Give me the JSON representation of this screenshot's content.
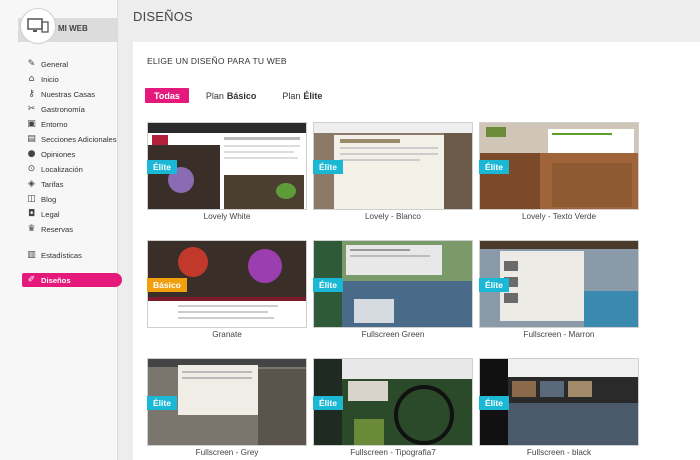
{
  "sidebar": {
    "brand_label": "MI WEB",
    "items": [
      {
        "label": "General",
        "icon": "wrench-icon"
      },
      {
        "label": "Inicio",
        "icon": "house-icon"
      },
      {
        "label": "Nuestras Casas",
        "icon": "key-icon"
      },
      {
        "label": "Gastronomía",
        "icon": "fork-knife-icon"
      },
      {
        "label": "Entorno",
        "icon": "picture-icon"
      },
      {
        "label": "Secciones Adicionales",
        "icon": "document-icon"
      },
      {
        "label": "Opiniones",
        "icon": "speech-bubble-icon"
      },
      {
        "label": "Localización",
        "icon": "map-pin-icon"
      },
      {
        "label": "Tarifas",
        "icon": "price-tag-icon"
      },
      {
        "label": "Blog",
        "icon": "rss-icon"
      },
      {
        "label": "Legal",
        "icon": "lock-icon"
      },
      {
        "label": "Reservas",
        "icon": "trophy-icon"
      },
      {
        "label": "Estadísticas",
        "icon": "bar-chart-icon"
      },
      {
        "label": "Diseños",
        "icon": "brush-icon",
        "active": true
      }
    ]
  },
  "header": {
    "title": "DISEÑOS"
  },
  "main": {
    "heading": "ELIGE UN DISEÑO PARA TU WEB",
    "filters": {
      "all": "Todas",
      "basic_prefix": "Plan",
      "basic_strong": "Básico",
      "elite_prefix": "Plan",
      "elite_strong": "Élite"
    },
    "designs": [
      {
        "name": "Lovely White",
        "badge": "Élite"
      },
      {
        "name": "Lovely - Blanco",
        "badge": "Élite"
      },
      {
        "name": "Lovely - Texto Verde",
        "badge": "Élite"
      },
      {
        "name": "Granate",
        "badge": "Básico"
      },
      {
        "name": "Fullscreen Green",
        "badge": "Élite"
      },
      {
        "name": "Fullscreen - Marron",
        "badge": "Élite"
      },
      {
        "name": "Fullscreen - Grey",
        "badge": "Élite"
      },
      {
        "name": "Fullscreen - Tipografia7",
        "badge": "Élite"
      },
      {
        "name": "Fullscreen - black",
        "badge": "Élite"
      }
    ]
  },
  "colors": {
    "accent": "#e5187b",
    "elite_badge": "#1bb8d6",
    "basic_badge": "#f0a00e"
  }
}
